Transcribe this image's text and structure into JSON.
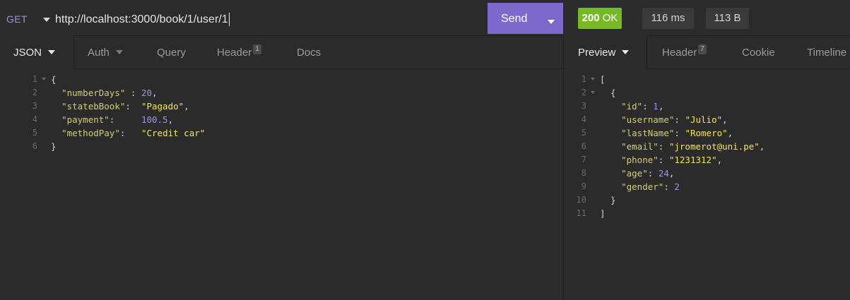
{
  "request": {
    "method": "GET",
    "url": "http://localhost:3000/book/1/user/1",
    "send_label": "Send"
  },
  "response_meta": {
    "status": "200",
    "status_text": "OK",
    "time": "116 ms",
    "size": "113 B"
  },
  "colors": {
    "accent": "#7d69cb",
    "status_ok": "#75ba24",
    "string": "#f4e45b",
    "number": "#a58fe8"
  },
  "request_tabs": [
    {
      "label": "JSON"
    },
    {
      "label": "Auth"
    },
    {
      "label": "Query"
    },
    {
      "label": "Header",
      "count": "1"
    },
    {
      "label": "Docs"
    }
  ],
  "response_tabs": [
    {
      "label": "Preview"
    },
    {
      "label": "Header",
      "count": "7"
    },
    {
      "label": "Cookie"
    },
    {
      "label": "Timeline"
    }
  ],
  "request_body": {
    "line_numbers": [
      "1",
      "2",
      "3",
      "4",
      "5",
      "6"
    ],
    "lines": [
      {
        "parts": [
          {
            "t": "p",
            "v": "{"
          }
        ]
      },
      {
        "parts": [
          {
            "t": "p",
            "v": "  "
          },
          {
            "t": "k",
            "v": "\"numberDays\""
          },
          {
            "t": "p",
            "v": " : "
          },
          {
            "t": "n",
            "v": "20"
          },
          {
            "t": "p",
            "v": ","
          }
        ]
      },
      {
        "parts": [
          {
            "t": "p",
            "v": "  "
          },
          {
            "t": "k",
            "v": "\"statebBook\""
          },
          {
            "t": "p",
            "v": ":  "
          },
          {
            "t": "s",
            "v": "\"Pagado\""
          },
          {
            "t": "p",
            "v": ","
          }
        ]
      },
      {
        "parts": [
          {
            "t": "p",
            "v": "  "
          },
          {
            "t": "k",
            "v": "\"payment\""
          },
          {
            "t": "p",
            "v": ":     "
          },
          {
            "t": "n",
            "v": "100.5"
          },
          {
            "t": "p",
            "v": ","
          }
        ]
      },
      {
        "parts": [
          {
            "t": "p",
            "v": "  "
          },
          {
            "t": "k",
            "v": "\"methodPay\""
          },
          {
            "t": "p",
            "v": ":   "
          },
          {
            "t": "s",
            "v": "\"Credit car\""
          }
        ]
      },
      {
        "parts": [
          {
            "t": "p",
            "v": "}"
          }
        ]
      }
    ]
  },
  "response_body": {
    "line_numbers": [
      "1",
      "2",
      "3",
      "4",
      "5",
      "6",
      "7",
      "8",
      "9",
      "10",
      "11"
    ],
    "lines": [
      {
        "parts": [
          {
            "t": "p",
            "v": "["
          }
        ]
      },
      {
        "parts": [
          {
            "t": "p",
            "v": "  {"
          }
        ]
      },
      {
        "parts": [
          {
            "t": "p",
            "v": "    "
          },
          {
            "t": "k",
            "v": "\"id\""
          },
          {
            "t": "p",
            "v": ": "
          },
          {
            "t": "n",
            "v": "1"
          },
          {
            "t": "p",
            "v": ","
          }
        ]
      },
      {
        "parts": [
          {
            "t": "p",
            "v": "    "
          },
          {
            "t": "k",
            "v": "\"username\""
          },
          {
            "t": "p",
            "v": ": "
          },
          {
            "t": "s",
            "v": "\"Julio\""
          },
          {
            "t": "p",
            "v": ","
          }
        ]
      },
      {
        "parts": [
          {
            "t": "p",
            "v": "    "
          },
          {
            "t": "k",
            "v": "\"lastName\""
          },
          {
            "t": "p",
            "v": ": "
          },
          {
            "t": "s",
            "v": "\"Romero\""
          },
          {
            "t": "p",
            "v": ","
          }
        ]
      },
      {
        "parts": [
          {
            "t": "p",
            "v": "    "
          },
          {
            "t": "k",
            "v": "\"email\""
          },
          {
            "t": "p",
            "v": ": "
          },
          {
            "t": "s",
            "v": "\"jromerot@uni.pe\""
          },
          {
            "t": "p",
            "v": ","
          }
        ]
      },
      {
        "parts": [
          {
            "t": "p",
            "v": "    "
          },
          {
            "t": "k",
            "v": "\"phone\""
          },
          {
            "t": "p",
            "v": ": "
          },
          {
            "t": "s",
            "v": "\"1231312\""
          },
          {
            "t": "p",
            "v": ","
          }
        ]
      },
      {
        "parts": [
          {
            "t": "p",
            "v": "    "
          },
          {
            "t": "k",
            "v": "\"age\""
          },
          {
            "t": "p",
            "v": ": "
          },
          {
            "t": "n",
            "v": "24"
          },
          {
            "t": "p",
            "v": ","
          }
        ]
      },
      {
        "parts": [
          {
            "t": "p",
            "v": "    "
          },
          {
            "t": "k",
            "v": "\"gender\""
          },
          {
            "t": "p",
            "v": ": "
          },
          {
            "t": "n",
            "v": "2"
          }
        ]
      },
      {
        "parts": [
          {
            "t": "p",
            "v": "  }"
          }
        ]
      },
      {
        "parts": [
          {
            "t": "p",
            "v": "]"
          }
        ]
      }
    ]
  }
}
